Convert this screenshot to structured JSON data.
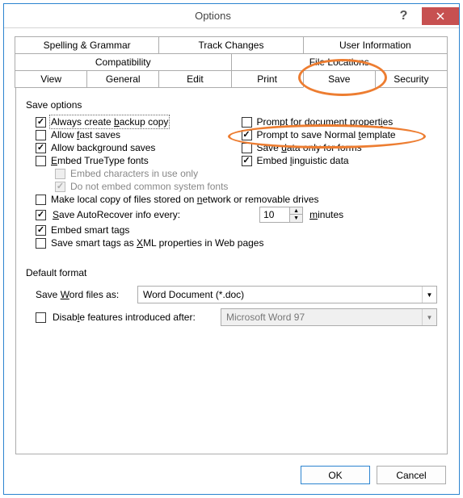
{
  "window": {
    "title": "Options"
  },
  "tabs": {
    "row1": [
      "Spelling & Grammar",
      "Track Changes",
      "User Information"
    ],
    "row2": [
      "Compatibility",
      "File Locations"
    ],
    "row3": [
      "View",
      "General",
      "Edit",
      "Print",
      "Save",
      "Security"
    ],
    "active": "Save"
  },
  "save": {
    "group_label": "Save options",
    "left": [
      {
        "label_pre": "Always create ",
        "u": "b",
        "label_post": "ackup copy",
        "checked": true,
        "focus": true
      },
      {
        "label_pre": "Allow ",
        "u": "f",
        "label_post": "ast saves",
        "checked": false
      },
      {
        "label_pre": "Allow back",
        "u": "g",
        "label_post": "round saves",
        "checked": true
      },
      {
        "label_pre": "",
        "u": "E",
        "label_post": "mbed TrueType fonts",
        "checked": false
      }
    ],
    "sub": [
      {
        "label": "Embed characters in use only",
        "checked": false,
        "disabled": true
      },
      {
        "label": "Do not embed common system fonts",
        "checked": true,
        "disabled": true
      }
    ],
    "right": [
      {
        "label_pre": "Prompt for document propert",
        "u": "i",
        "label_post": "es",
        "checked": false
      },
      {
        "label_pre": "Prompt to save Normal ",
        "u": "t",
        "label_post": "emplate",
        "checked": true,
        "highlight": true
      },
      {
        "label_pre": "Save ",
        "u": "d",
        "label_post": "ata only for forms",
        "checked": false
      },
      {
        "label_pre": "Embed ",
        "u": "l",
        "label_post": "inguistic data",
        "checked": true
      }
    ],
    "full": [
      {
        "label_pre": "Make local copy of files stored on ",
        "u": "n",
        "label_post": "etwork or removable drives",
        "checked": false
      }
    ],
    "autorecover": {
      "label_pre": "",
      "u": "S",
      "label_mid": "ave AutoRecover info every:",
      "value": "10",
      "unit_pre": "",
      "unit_u": "m",
      "unit_post": "inutes",
      "checked": true
    },
    "full2": [
      {
        "label_pre": "Embed smart ta",
        "u": "g",
        "label_post": "s",
        "checked": true
      },
      {
        "label_pre": "Save smart tags as ",
        "u": "X",
        "label_post": "ML properties in Web pages",
        "checked": false
      }
    ]
  },
  "default_format": {
    "label": "Default format",
    "save_as_pre": "Save ",
    "save_as_u": "W",
    "save_as_post": "ord files as:",
    "save_as_value": "Word Document (*.doc)",
    "disable_pre": "Disab",
    "disable_u": "l",
    "disable_post": "e features introduced after:",
    "disable_checked": false,
    "disable_value": "Microsoft Word 97"
  },
  "buttons": {
    "ok": "OK",
    "cancel": "Cancel"
  }
}
